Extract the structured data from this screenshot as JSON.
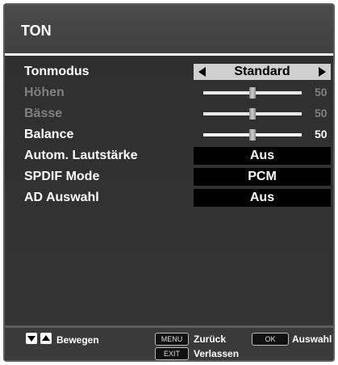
{
  "title": "TON",
  "rows": {
    "tonmodus": {
      "label": "Tonmodus",
      "value": "Standard"
    },
    "hoehen": {
      "label": "Höhen",
      "value": "50",
      "level": 0.5
    },
    "baesse": {
      "label": "Bässe",
      "value": "50",
      "level": 0.5
    },
    "balance": {
      "label": "Balance",
      "value": "50",
      "level": 0.5
    },
    "lautstaerke": {
      "label": "Autom. Lautstärke",
      "value": "Aus"
    },
    "spdif": {
      "label": "SPDIF Mode",
      "value": "PCM"
    },
    "ad": {
      "label": "AD Auswahl",
      "value": "Aus"
    }
  },
  "footer": {
    "move_label": "Bewegen",
    "menu_key": "MENU",
    "back_label": "Zurück",
    "ok_key": "OK",
    "select_label": "Auswahl",
    "exit_key": "EXIT",
    "exit_label": "Verlassen"
  },
  "icons": {
    "left_arrow": "arrow-left-icon",
    "right_arrow": "arrow-right-icon",
    "down_button": "down-arrow-icon",
    "up_button": "up-arrow-icon"
  },
  "colors": {
    "background": "#5e5e5e",
    "selector": "#cfcfcf",
    "value_box": "#000000",
    "disabled_text": "#808080"
  }
}
